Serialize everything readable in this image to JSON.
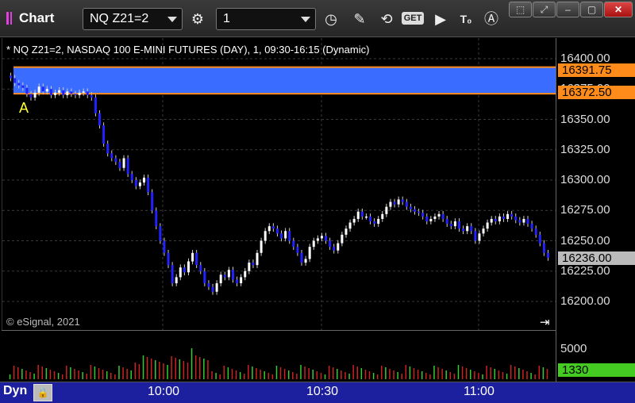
{
  "window": {
    "title": "Chart"
  },
  "toolbar": {
    "symbol": "NQ Z21=2",
    "interval": "1",
    "icons": [
      "settings-gear-icon",
      "clock-icon",
      "pencil-icon",
      "study-icon",
      "get-icon",
      "play-icon",
      "text-icon",
      "alert-icon"
    ],
    "get_label": "GET"
  },
  "window_controls": [
    "pin-icon",
    "restore-icon",
    "minimize-icon",
    "maximize-icon",
    "close-icon"
  ],
  "chart": {
    "symbol_line": "* NQ Z21=2, NASDAQ 100 E-MINI FUTURES (DAY), 1, 09:30-16:15 (Dynamic)",
    "copyright": "© eSignal, 2021",
    "marker_label": "A",
    "y_ticks": [
      "16400.00",
      "16375.00",
      "16350.00",
      "16325.00",
      "16300.00",
      "16275.00",
      "16250.00",
      "16225.00",
      "16200.00"
    ],
    "zone_high": "16391.75",
    "zone_low": "16372.50",
    "last_price": "16236.00",
    "zone_color": "#3a6cff",
    "zone_border_color": "#ff8c1a",
    "volume_tick": "5000",
    "last_volume": "1330",
    "last_volume_color": "#44cc22",
    "time_labels": [
      "10:00",
      "10:30",
      "11:00"
    ]
  },
  "bottombar": {
    "mode": "Dyn"
  },
  "chart_data": {
    "type": "candlestick",
    "ylim": [
      16188,
      16412
    ],
    "closes": [
      16384,
      16380,
      16378,
      16376,
      16371,
      16368,
      16372,
      16377,
      16373,
      16375,
      16370,
      16372,
      16374,
      16370,
      16373,
      16371,
      16370,
      16372,
      16373,
      16370,
      16368,
      16355,
      16345,
      16330,
      16322,
      16318,
      16315,
      16310,
      16318,
      16305,
      16300,
      16295,
      16298,
      16302,
      16290,
      16275,
      16262,
      16250,
      16240,
      16230,
      16215,
      16220,
      16228,
      16224,
      16233,
      16240,
      16230,
      16225,
      16215,
      16212,
      16208,
      16215,
      16222,
      16220,
      16226,
      16218,
      16215,
      16220,
      16225,
      16232,
      16230,
      16240,
      16250,
      16258,
      16262,
      16260,
      16256,
      16252,
      16258,
      16250,
      16245,
      16240,
      16232,
      16235,
      16245,
      16250,
      16252,
      16254,
      16250,
      16245,
      16242,
      16248,
      16255,
      16260,
      16265,
      16268,
      16274,
      16270,
      16270,
      16266,
      16264,
      16268,
      16272,
      16278,
      16282,
      16280,
      16284,
      16282,
      16278,
      16276,
      16274,
      16273,
      16270,
      16266,
      16268,
      16270,
      16272,
      16268,
      16264,
      16262,
      16266,
      16260,
      16258,
      16262,
      16258,
      16250,
      16256,
      16260,
      16265,
      16268,
      16266,
      16270,
      16268,
      16272,
      16270,
      16267,
      16265,
      16268,
      16264,
      16260,
      16255,
      16248,
      16240,
      16236
    ],
    "volume_unit_max": 5000
  }
}
